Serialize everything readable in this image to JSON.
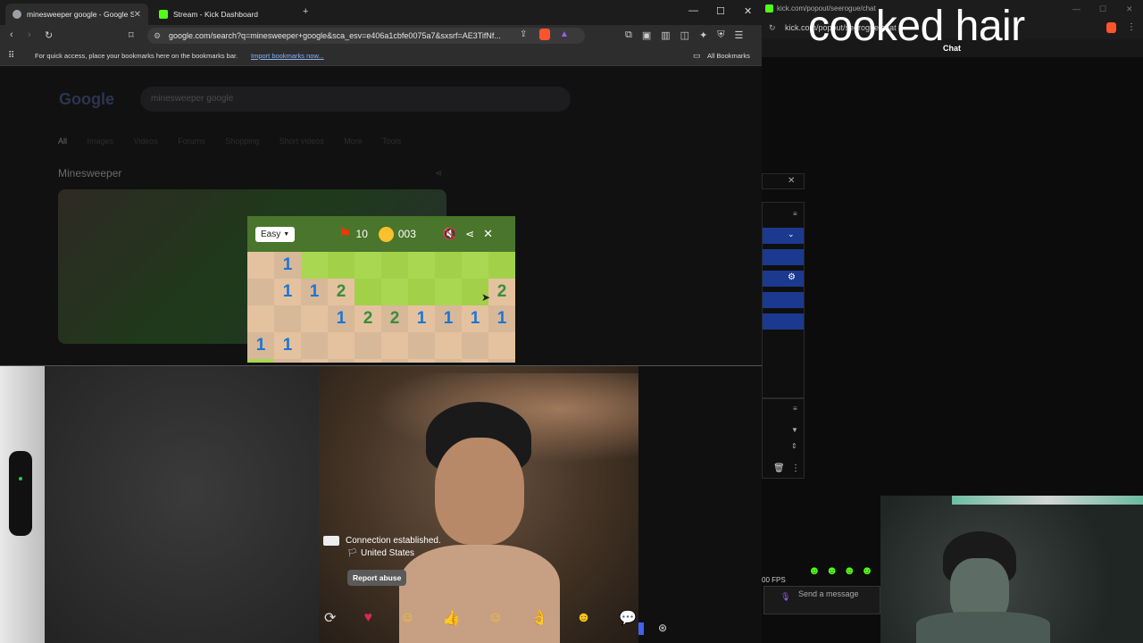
{
  "browser": {
    "tabs": [
      {
        "title": "minesweeper google - Google S"
      },
      {
        "title": "Stream - Kick Dashboard"
      }
    ],
    "url": "google.com/search?q=minesweeper+google&sca_esv=e406a1cbfe0075a7&sxsrf=AE3TifNf...",
    "bookmarks_hint": "For quick access, place your bookmarks here on the bookmarks bar.",
    "import_link": "Import bookmarks now...",
    "all_bookmarks": "All Bookmarks"
  },
  "google": {
    "logo": "Google",
    "query": "minesweeper google",
    "tabs": [
      "All",
      "Images",
      "Videos",
      "Forums",
      "Shopping",
      "Short videos",
      "More",
      "Tools"
    ],
    "result_title": "Minesweeper"
  },
  "minesweeper": {
    "difficulty": "Easy",
    "flags": "10",
    "timer": "003",
    "colors": {
      "unrevealed_light": "#aad751",
      "unrevealed_dark": "#a2d149",
      "revealed_light": "#e5c29f",
      "revealed_dark": "#d7b899",
      "one": "#1976d2",
      "two": "#388e3c"
    }
  },
  "right_window": {
    "url": "kick.com/popout/seerogue/chat",
    "overlay_text": "cooked hair",
    "chat_label": "Chat",
    "fps": "00 FPS",
    "message_placeholder": "Send a message"
  },
  "video_chat": {
    "status": "Connection established.",
    "country": "United States",
    "report": "Report abuse"
  }
}
